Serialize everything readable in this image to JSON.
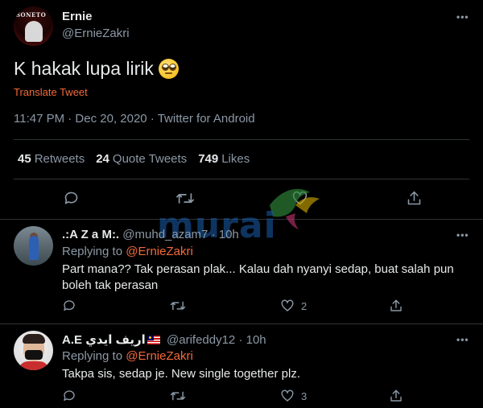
{
  "main_tweet": {
    "display_name": "Ernie",
    "handle": "@ErnieZakri",
    "avatar_text": "SONETO",
    "text": "K hakak lupa lirik",
    "emoji": "face-with-rolling-eyes",
    "translate_label": "Translate Tweet",
    "meta": "11:47 PM · Dec 20, 2020 · Twitter for Android",
    "stats": {
      "retweets_count": "45",
      "retweets_label": "Retweets",
      "quote_count": "24",
      "quote_label": "Quote Tweets",
      "likes_count": "749",
      "likes_label": "Likes"
    }
  },
  "watermark": {
    "text": "murai"
  },
  "replies": [
    {
      "display_name": ".:A Z a M:.",
      "handle": "@muhd_azam7 · 10h",
      "replying_prefix": "Replying to",
      "replying_mention": "@ErnieZakri",
      "text": "Part mana?? Tak perasan plak... Kalau dah nyanyi sedap, buat salah pun boleh tak perasan",
      "like_count": "2"
    },
    {
      "display_name": "A.E اريف ايدي",
      "flag": "malaysia-flag",
      "handle": "@arifeddy12 · 10h",
      "replying_prefix": "Replying to",
      "replying_mention": "@ErnieZakri",
      "text": "Takpa sis, sedap je. New single together plz.",
      "like_count": "3"
    }
  ],
  "colors": {
    "background": "#000000",
    "accent": "#f46a3b",
    "secondary_text": "#8b98a5",
    "primary_text": "#e7e9ea",
    "divider": "#2f3336"
  }
}
